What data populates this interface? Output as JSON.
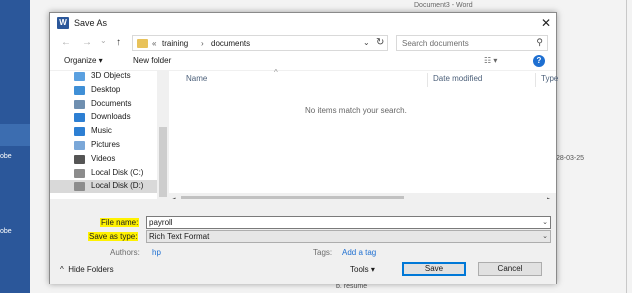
{
  "background": {
    "window_title": "Document3 - Word",
    "left_text_1": "obe",
    "left_text_2": "obe",
    "date_text": "28-03-25",
    "bottom_text": "b.  resume"
  },
  "dialog": {
    "title": "Save As",
    "app_icon_letter": "W",
    "close_glyph": "✕"
  },
  "nav": {
    "back": "←",
    "forward": "→",
    "recent": "⌄",
    "up": "↑",
    "path_prefix": "«",
    "path": [
      "training",
      "documents"
    ],
    "path_separator": "›",
    "dropdown": "⌄",
    "refresh": "↻",
    "search_placeholder": "Search documents",
    "search_icon": "⚲"
  },
  "toolbar": {
    "organize_label": "Organize ▾",
    "new_folder_label": "New folder",
    "view_glyph": "☷ ▾",
    "help_glyph": "?"
  },
  "navpane": {
    "items": [
      {
        "label": "3D Objects",
        "icon": "cube-icon",
        "color": "#5aa0e0"
      },
      {
        "label": "Desktop",
        "icon": "desktop-icon",
        "color": "#3f8fd6"
      },
      {
        "label": "Documents",
        "icon": "documents-icon",
        "color": "#6f8fb0"
      },
      {
        "label": "Downloads",
        "icon": "downloads-icon",
        "color": "#2d7fd3"
      },
      {
        "label": "Music",
        "icon": "music-icon",
        "color": "#2d7fd3"
      },
      {
        "label": "Pictures",
        "icon": "pictures-icon",
        "color": "#7aa7d8"
      },
      {
        "label": "Videos",
        "icon": "videos-icon",
        "color": "#555555"
      },
      {
        "label": "Local Disk (C:)",
        "icon": "drive-icon",
        "color": "#8c8c8c"
      },
      {
        "label": "Local Disk (D:)",
        "icon": "drive-icon",
        "color": "#8c8c8c"
      }
    ]
  },
  "filepane": {
    "columns": [
      "Name",
      "Date modified",
      "Type"
    ],
    "sort_indicator": "^",
    "empty_message": "No items match your search.",
    "scroll_left": "◂",
    "scroll_right": "▸"
  },
  "form": {
    "file_name_label": "File name:",
    "file_name_value": "payroll",
    "save_type_label": "Save as type:",
    "save_type_value": "Rich Text Format",
    "authors_label": "Authors:",
    "authors_value": "hp",
    "tags_label": "Tags:",
    "tags_value": "Add a tag",
    "dropdown_glyph": "⌄"
  },
  "footer": {
    "hide_folders_label": "Hide Folders",
    "hide_folders_glyph": "^",
    "tools_label": "Tools  ▾",
    "save_label": "Save",
    "cancel_label": "Cancel"
  }
}
